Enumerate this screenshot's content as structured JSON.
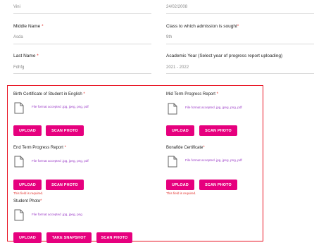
{
  "form": {
    "first_name": {
      "value": "Vini"
    },
    "dob": {
      "value": "24/02/2008"
    },
    "middle_name": {
      "label": "Middle Name",
      "required": "*",
      "value": "Asda"
    },
    "class_sought": {
      "label": "Class to which admission is sought",
      "required": "*",
      "value": "9th"
    },
    "last_name": {
      "label": "Last Name",
      "required": "*",
      "value": "Fdhfg"
    },
    "academic_year": {
      "label": "Academic Year (Select year of progress report uploading)",
      "value": "2021 - 2022"
    }
  },
  "uploads": {
    "birth_certificate": {
      "label": "Birth Certificate of Student in English",
      "required": "*",
      "hint": "File format accepted .jpg, jpeg, png, pdf",
      "upload": "UPLOAD",
      "scan": "SCAN PHOTO"
    },
    "mid_term": {
      "label": "Mid Term Progress Report",
      "required": "*",
      "hint": "File format accepted .jpg, jpeg, png, pdf",
      "upload": "UPLOAD",
      "scan": "SCAN PHOTO"
    },
    "end_term": {
      "label": "End Term Progress Report",
      "required": "*",
      "hint": "File format accepted .jpg, jpeg, png, pdf",
      "upload": "UPLOAD",
      "scan": "SCAN PHOTO",
      "error": "This field is required."
    },
    "bonafide": {
      "label": "Bonafide Certificate",
      "required": "*",
      "hint": "File format accepted .jpg, jpeg, png, pdf",
      "upload": "UPLOAD",
      "scan": "SCAN PHOTO",
      "error": "This field is required."
    },
    "student_photo": {
      "label": "Student Photo",
      "required": "*",
      "hint": "File format accepted .jpg, jpeg, png",
      "upload": "UPLOAD",
      "snapshot": "TAKE SNAPSHOT",
      "scan": "SCAN PHOTO"
    }
  },
  "colors": {
    "accent": "#e6007e",
    "error": "#e3342f",
    "highlight_box": "#e8101f",
    "hint": "#9b3bc7"
  },
  "icons": {
    "file": "file-icon"
  }
}
